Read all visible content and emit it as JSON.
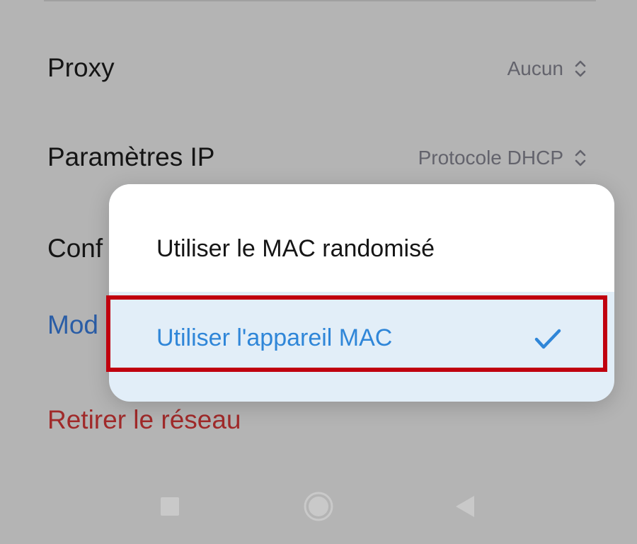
{
  "settings": {
    "proxy": {
      "label": "Proxy",
      "value": "Aucun",
      "icon": "up-down-chevron-icon"
    },
    "ip_settings": {
      "label": "Paramètres IP",
      "value": "Protocole DHCP",
      "icon": "up-down-chevron-icon"
    },
    "privacy_partial_label": "Conf",
    "modify_partial_label": "Mod",
    "remove_network_label": "Retirer le réseau"
  },
  "mac_popup": {
    "options": [
      {
        "label": "Utiliser le MAC randomisé",
        "selected": false
      },
      {
        "label": "Utiliser l'appareil MAC",
        "selected": true,
        "icon": "check-icon"
      }
    ]
  },
  "nav_bar": {
    "icons": [
      "recents-square-icon",
      "home-circle-icon",
      "back-triangle-icon"
    ]
  },
  "colors": {
    "selected_text": "#2f86d8",
    "highlight_border": "#c0000f",
    "danger_text": "#a02a2a",
    "link_text": "#2a5da6"
  }
}
